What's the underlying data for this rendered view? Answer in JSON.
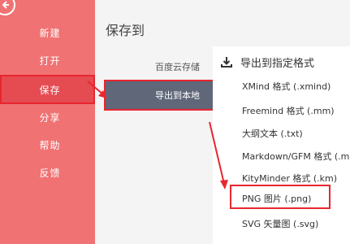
{
  "sidebar": {
    "back_icon": "back-arrow-icon",
    "items": [
      {
        "label": "新建"
      },
      {
        "label": "打开"
      },
      {
        "label": "保存"
      },
      {
        "label": "分享"
      },
      {
        "label": "帮助"
      },
      {
        "label": "反馈"
      }
    ]
  },
  "middle": {
    "title": "保存到",
    "items": [
      {
        "label": "百度云存储"
      },
      {
        "label": "导出到本地"
      }
    ]
  },
  "right": {
    "header": "导出到指定格式",
    "header_icon": "download-icon",
    "formats": [
      {
        "label": "XMind 格式 (.xmind)"
      },
      {
        "label": "Freemind 格式 (.mm)"
      },
      {
        "label": "大纲文本 (.txt)"
      },
      {
        "label": "Markdown/GFM 格式 (.md)"
      },
      {
        "label": "KityMinder 格式 (.km)"
      },
      {
        "label": "PNG 图片 (.png)"
      },
      {
        "label": "SVG 矢量图 (.svg)"
      }
    ]
  },
  "colors": {
    "sidebar": "#f07273",
    "sidebar_active": "#e44c52",
    "highlight": "#e8262f",
    "middle_active": "#5f6779"
  }
}
